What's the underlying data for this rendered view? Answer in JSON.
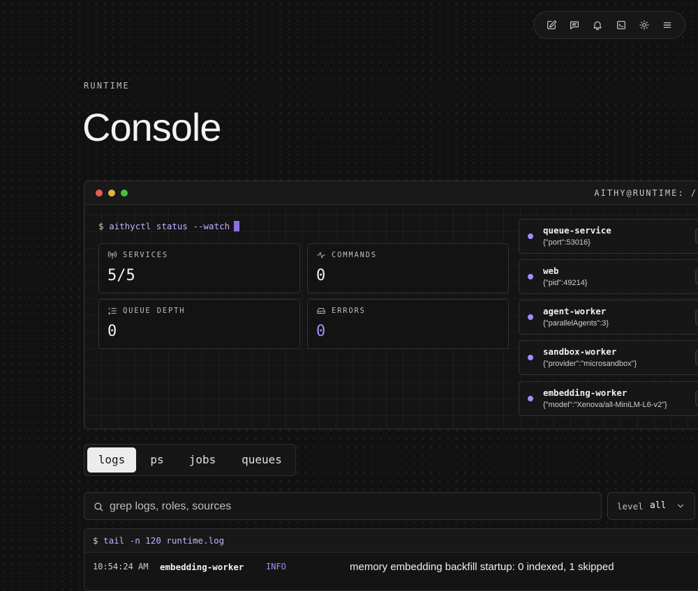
{
  "toolbar": {
    "icons": [
      "edit-icon",
      "message-icon",
      "bell-icon",
      "terminal-icon",
      "sun-icon",
      "menu-icon"
    ]
  },
  "header": {
    "eyebrow": "RUNTIME",
    "title": "Console"
  },
  "terminal": {
    "host": "AITHY@RUNTIME: /",
    "prompt_symbol": "$",
    "command": "aithyctl status --watch",
    "stats": [
      {
        "label": "SERVICES",
        "value": "5/5",
        "icon": "broadcast-icon"
      },
      {
        "label": "COMMANDS",
        "value": "0",
        "icon": "activity-icon"
      },
      {
        "label": "QUEUE DEPTH",
        "value": "0",
        "icon": "list-icon"
      },
      {
        "label": "ERRORS",
        "value": "0",
        "icon": "drive-icon"
      }
    ],
    "services": [
      {
        "name": "queue-service",
        "meta": "{\"port\":53016}"
      },
      {
        "name": "web",
        "meta": "{\"pid\":49214}"
      },
      {
        "name": "agent-worker",
        "meta": "{\"parallelAgents\":3}"
      },
      {
        "name": "sandbox-worker",
        "meta": "{\"provider\":\"microsandbox\"}"
      },
      {
        "name": "embedding-worker",
        "meta": "{\"model\":\"Xenova/all-MiniLM-L6-v2\"}"
      }
    ]
  },
  "tabs": [
    "logs",
    "ps",
    "jobs",
    "queues"
  ],
  "search": {
    "placeholder": "grep logs, roles, sources"
  },
  "level_filter": {
    "label": "level",
    "value": "all"
  },
  "logs": {
    "prompt_symbol": "$",
    "command": "tail -n 120 runtime.log",
    "rows": [
      {
        "time": "10:54:24 AM",
        "source": "embedding-worker",
        "level": "INFO",
        "message": "memory embedding backfill startup: 0 indexed, 1 skipped"
      }
    ]
  },
  "colors": {
    "accent": "#a78bfa",
    "background": "#111111"
  }
}
